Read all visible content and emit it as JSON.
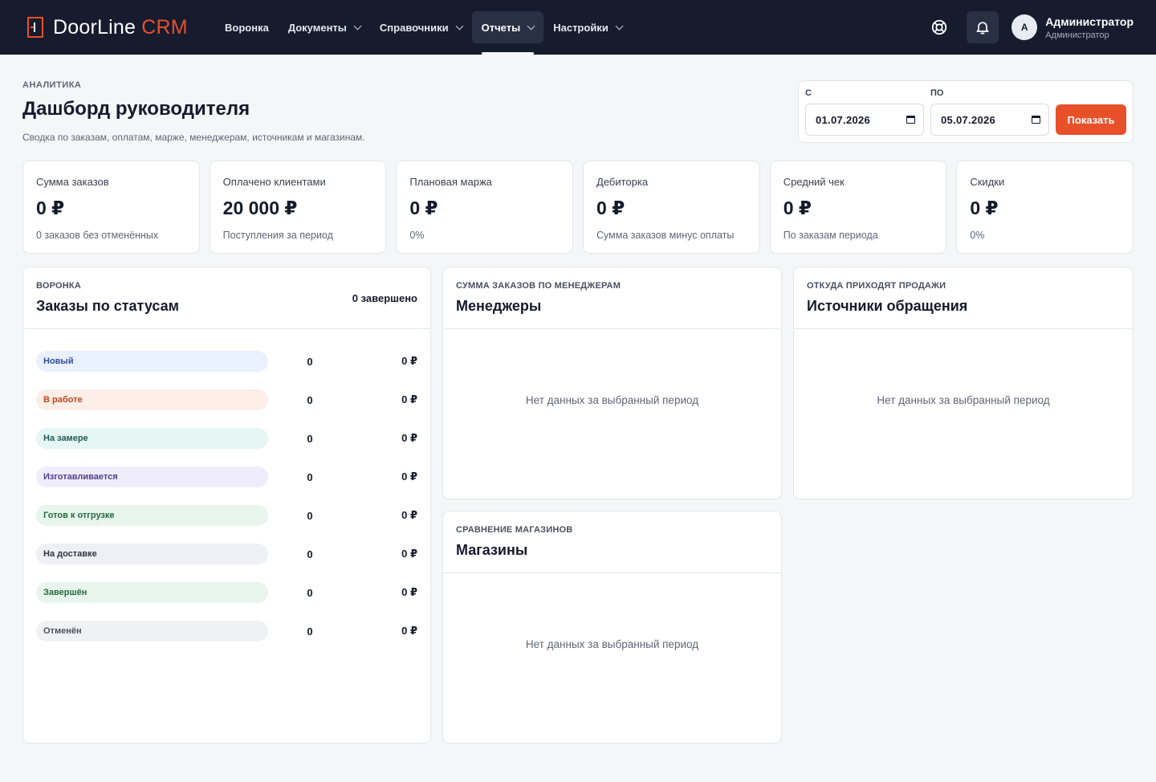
{
  "brand": {
    "name_main": "DoorLine",
    "name_accent": "CRM",
    "accent_color": "#e8502a"
  },
  "nav": {
    "items": [
      {
        "label": "Воронка",
        "dropdown": false
      },
      {
        "label": "Документы",
        "dropdown": true
      },
      {
        "label": "Справочники",
        "dropdown": true
      },
      {
        "label": "Отчеты",
        "dropdown": true,
        "active": true
      },
      {
        "label": "Настройки",
        "dropdown": true
      }
    ]
  },
  "topbar": {
    "help_icon": "lifebuoy-icon",
    "notifications_icon": "bell-icon",
    "user": {
      "initial": "А",
      "name": "Администратор",
      "role": "Администратор"
    }
  },
  "header": {
    "eyebrow": "АНАЛИТИКА",
    "title": "Дашборд руководителя",
    "subtitle": "Сводка по заказам, оплатам, марже, менеджерам, источникам и магазинам."
  },
  "filter": {
    "from_label": "С",
    "from_value": "01.07.2026",
    "to_label": "ПО",
    "to_value": "05.07.2026",
    "submit_label": "Показать"
  },
  "kpis": [
    {
      "label": "Сумма заказов",
      "value": "0 ₽",
      "note": "0 заказов без отменённых"
    },
    {
      "label": "Оплачено клиентами",
      "value": "20 000 ₽",
      "note": "Поступления за период"
    },
    {
      "label": "Плановая маржа",
      "value": "0 ₽",
      "note": "0%"
    },
    {
      "label": "Дебиторка",
      "value": "0 ₽",
      "note": "Сумма заказов минус оплаты"
    },
    {
      "label": "Средний чек",
      "value": "0 ₽",
      "note": "По заказам периода"
    },
    {
      "label": "Скидки",
      "value": "0 ₽",
      "note": "0%"
    }
  ],
  "funnel": {
    "eyebrow": "ВОРОНКА",
    "title": "Заказы по статусам",
    "meta": "0 завершено",
    "statuses": [
      {
        "label": "Новый",
        "count": "0",
        "sum": "0 ₽",
        "bg": "#eaf1fe",
        "fg": "#2f4f9a"
      },
      {
        "label": "В работе",
        "count": "0",
        "sum": "0 ₽",
        "bg": "#fdeee7",
        "fg": "#c2461d"
      },
      {
        "label": "На замере",
        "count": "0",
        "sum": "0 ₽",
        "bg": "#e6f6f4",
        "fg": "#1f5c55"
      },
      {
        "label": "Изготавливается",
        "count": "0",
        "sum": "0 ₽",
        "bg": "#efedfb",
        "fg": "#4f3f8f"
      },
      {
        "label": "Готов к отгрузке",
        "count": "0",
        "sum": "0 ₽",
        "bg": "#e7f5ec",
        "fg": "#236a3c"
      },
      {
        "label": "На доставке",
        "count": "0",
        "sum": "0 ₽",
        "bg": "#eef0f5",
        "fg": "#2d3346"
      },
      {
        "label": "Завершён",
        "count": "0",
        "sum": "0 ₽",
        "bg": "#e8f5ec",
        "fg": "#236a3c"
      },
      {
        "label": "Отменён",
        "count": "0",
        "sum": "0 ₽",
        "bg": "#f0f1f4",
        "fg": "#4a5062"
      }
    ]
  },
  "managers": {
    "eyebrow": "СУММА ЗАКАЗОВ ПО МЕНЕДЖЕРАМ",
    "title": "Менеджеры",
    "empty": "Нет данных за выбранный период"
  },
  "sources": {
    "eyebrow": "ОТКУДА ПРИХОДЯТ ПРОДАЖИ",
    "title": "Источники обращения",
    "empty": "Нет данных за выбранный период"
  },
  "stores": {
    "eyebrow": "СРАВНЕНИЕ МАГАЗИНОВ",
    "title": "Магазины",
    "empty": "Нет данных за выбранный период"
  }
}
